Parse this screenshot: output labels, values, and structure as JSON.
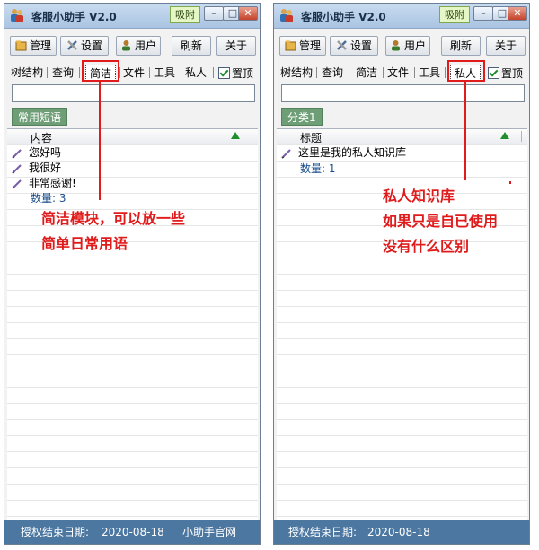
{
  "app": {
    "title": "客服小助手 V2.0",
    "pin_label": "吸附"
  },
  "window_buttons": {
    "minimize": "–",
    "restore": "□",
    "close": "✕"
  },
  "toolbar": {
    "manage": "管理",
    "settings": "设置",
    "users": "用户",
    "refresh": "刷新",
    "about": "关于"
  },
  "tabs": [
    {
      "label": "树结构"
    },
    {
      "label": "查询"
    },
    {
      "label": "简洁"
    },
    {
      "label": "文件"
    },
    {
      "label": "工具"
    },
    {
      "label": "私人"
    }
  ],
  "pin_top_label": "置顶",
  "left": {
    "active_tab": "简洁",
    "category": "常用短语",
    "column": "内容",
    "items": [
      {
        "text": "您好吗"
      },
      {
        "text": "我很好"
      },
      {
        "text": "非常感谢!"
      }
    ],
    "count": "数量: 3",
    "annotation": [
      "简洁模块，可以放一些",
      "简单日常用语"
    ]
  },
  "right": {
    "active_tab": "私人",
    "category": "分类1",
    "column": "标题",
    "items": [
      {
        "text": "这里是我的私人知识库"
      }
    ],
    "count": "数量: 1",
    "annotation": [
      "私人知识库",
      "如果只是自已使用",
      "没有什么区别"
    ]
  },
  "status": {
    "expiry_label": "授权结束日期:",
    "expiry_date": "2020-08-18",
    "site_link": "小助手官网"
  },
  "colors": {
    "annotation": "#e01b1b",
    "statusbar": "#4c77a0",
    "category": "#6d9e76"
  }
}
